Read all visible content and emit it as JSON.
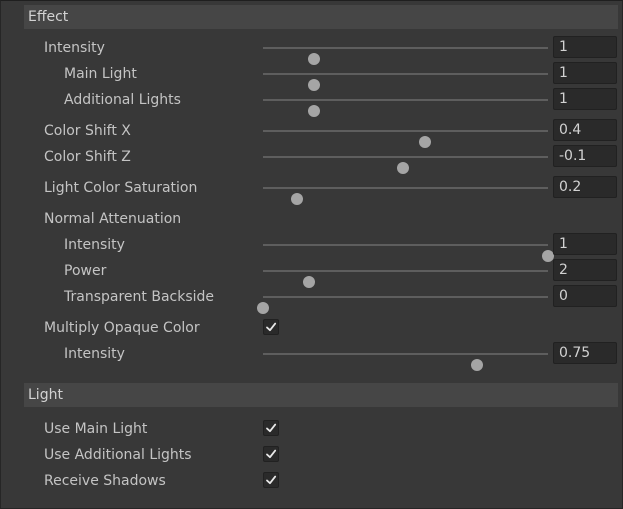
{
  "sections": {
    "effect": {
      "title": "Effect",
      "intensity": {
        "label": "Intensity",
        "value": "1",
        "level": 0.18
      },
      "main_light": {
        "label": "Main Light",
        "value": "1",
        "level": 0.18
      },
      "additional_lights": {
        "label": "Additional Lights",
        "value": "1",
        "level": 0.18
      },
      "color_shift_x": {
        "label": "Color Shift X",
        "value": "0.4",
        "level": 0.57
      },
      "color_shift_z": {
        "label": "Color Shift Z",
        "value": "-0.1",
        "level": 0.49
      },
      "light_color_saturation": {
        "label": "Light Color Saturation",
        "value": "0.2",
        "level": 0.12
      },
      "normal_attenuation": {
        "label": "Normal Attenuation"
      },
      "na_intensity": {
        "label": "Intensity",
        "value": "1",
        "level": 1.0
      },
      "na_power": {
        "label": "Power",
        "value": "2",
        "level": 0.16
      },
      "na_transparent_backside": {
        "label": "Transparent Backside",
        "value": "0",
        "level": 0.0
      },
      "multiply_opaque_color": {
        "label": "Multiply Opaque Color",
        "checked": true
      },
      "moc_intensity": {
        "label": "Intensity",
        "value": "0.75",
        "level": 0.75
      }
    },
    "light": {
      "title": "Light",
      "use_main_light": {
        "label": "Use Main Light",
        "checked": true
      },
      "use_additional_lights": {
        "label": "Use Additional Lights",
        "checked": true
      },
      "receive_shadows": {
        "label": "Receive Shadows",
        "checked": true
      }
    }
  },
  "colors": {
    "background": "#383838",
    "header": "#464646",
    "track": "#5e5e5e",
    "thumb": "#a5a5a5",
    "field": "#2a2a2a",
    "text": "#c4c4c4"
  },
  "icons": {
    "checkmark": "check-icon"
  }
}
